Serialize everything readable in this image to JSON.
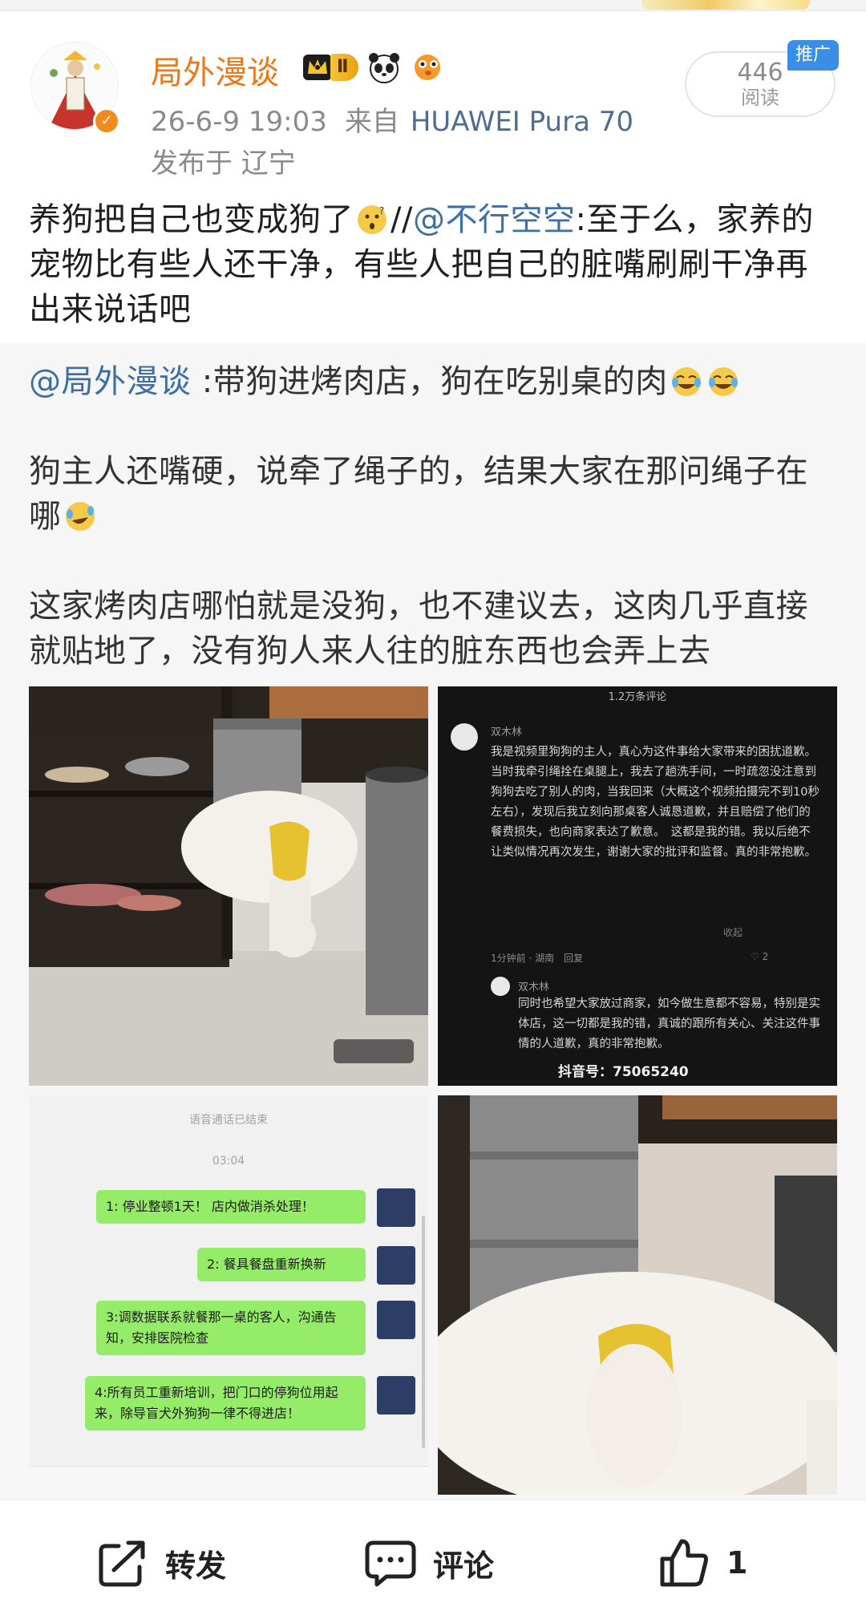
{
  "post": {
    "username": "局外漫谈",
    "level_badge": "Ⅱ",
    "timestamp": "26-6-9 19:03",
    "source_prefix": "来自",
    "device": "HUAWEI Pura 70",
    "location": "发布于 辽宁",
    "read_count": "446",
    "read_label": "阅读",
    "promo_tag": "推广",
    "text_before_emoji": "养狗把自己也变成狗了",
    "text_sep": "//",
    "mention": "@不行空空",
    "text_after_mention": ":至于么，家养的宠物比有些人还干净，有些人把自己的脏嘴刷刷干净再出来说话吧"
  },
  "repost": {
    "mention": "@局外漫谈",
    "line1": " :带狗进烤肉店，狗在吃别桌的肉",
    "line2": "狗主人还嘴硬，说牵了绳子的，结果大家在那问绳子在哪",
    "line3": "这家烤肉店哪怕就是没狗，也不建议去，这肉几乎直接就贴地了，没有狗人来人往的脏东西也会弄上去"
  },
  "image2": {
    "header": "1.2万条评论",
    "comment1_name": "双木林",
    "comment1_text": "我是视频里狗狗的主人，真心为这件事给大家带来的困扰道歉。　当时我牵引绳拴在桌腿上，我去了趟洗手间，一时疏忽没注意到狗狗去吃了别人的肉，当我回来（大概这个视频拍摄完不到10秒左右），发现后我立刻向那桌客人诚恳道歉，并且赔偿了他们的餐费损失，也向商家表达了歉意。　这都是我的错。我以后绝不让类似情况再次发生，谢谢大家的批评和监督。真的非常抱歉。",
    "comment1_more": "收起",
    "comment1_meta": "1分钟前 · 湖南　回复",
    "comment1_likes": "♡ 2",
    "comment2_name": "双木林",
    "comment2_text": "同时也希望大家放过商家，如今做生意都不容易，特别是实体店，这一切都是我的错，真诚的跟所有关心、关注这件事情的人道歉，真的非常抱歉。",
    "douyin": "抖音号：75065240"
  },
  "image3": {
    "system_top": "语音通话已结束",
    "time": "03:04",
    "messages": [
      "1: 停业整顿1天！ 店内做消杀处理！",
      "2: 餐具餐盘重新换新",
      "3:调数据联系就餐那一桌的客人，沟通告知，安排医院检查",
      "4:所有员工重新培训，把门口的停狗位用起来，除导盲犬外狗狗一律不得进店！"
    ]
  },
  "actions": {
    "repost_label": "转发",
    "comment_label": "评论",
    "like_count": "1"
  },
  "colors": {
    "username": "#e9791a",
    "mention": "#3d6fa6",
    "device": "#4f6d8f",
    "promo": "#3a8ee6",
    "repost_bg": "#f6f6f6",
    "chat_bubble": "#95ec69"
  },
  "icons": {
    "verify": "verified-badge-icon",
    "crown": "crown-icon",
    "panda": "panda-emoji-icon",
    "pufferfish": "pufferfish-emoji-icon",
    "repost": "share-arrow-icon",
    "comment": "comment-bubble-icon",
    "like": "thumbs-up-icon"
  }
}
